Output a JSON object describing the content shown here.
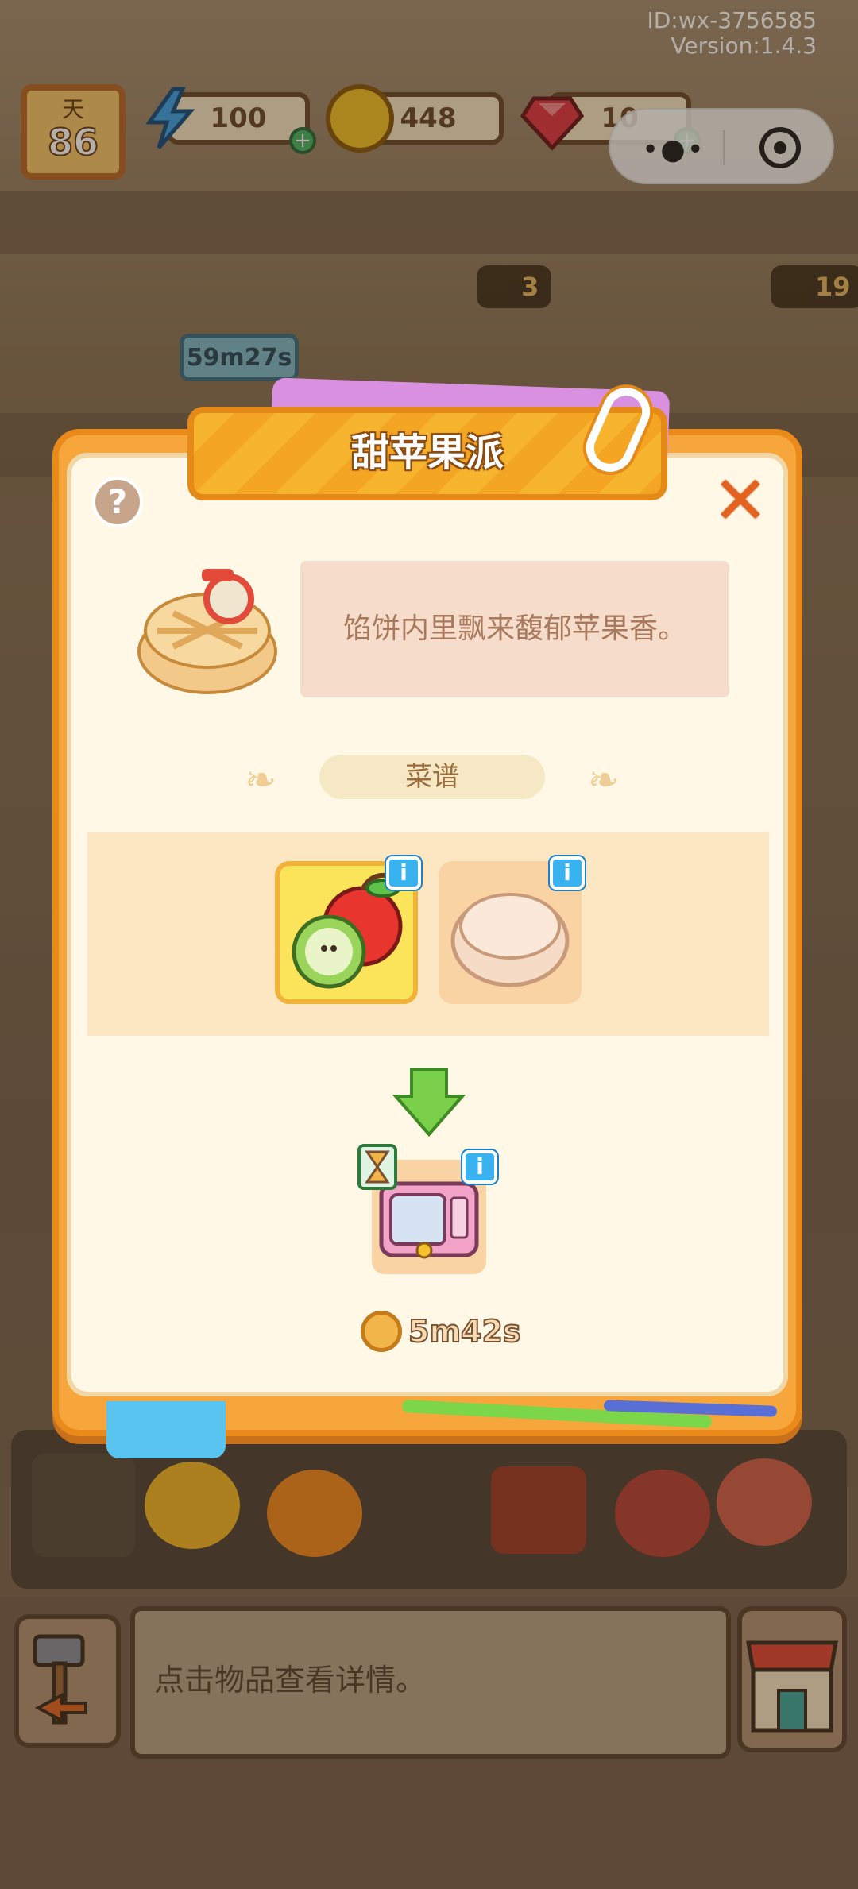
{
  "hud": {
    "id_line": "ID:wx-3756585",
    "version_line": "Version:1.4.3",
    "day_label": "天",
    "day_value": "86",
    "energy": "100",
    "coins": "448",
    "gems": "10",
    "energy_icon": "lightning-icon",
    "coin_icon": "coin-icon",
    "gem_icon": "ruby-icon"
  },
  "background": {
    "station_badges": [
      "3",
      "19"
    ],
    "station_timer": "59m27s"
  },
  "modal": {
    "title": "甜苹果派",
    "help": "?",
    "close": "✕",
    "description": "馅饼内里飘来馥郁苹果香。",
    "recipe_label": "菜谱",
    "ingredients": [
      {
        "name": "apples",
        "icon": "apple-icon",
        "info": "i",
        "selected": true
      },
      {
        "name": "pie-crust",
        "icon": "pie-crust-icon",
        "info": "i",
        "selected": false
      }
    ],
    "machine": {
      "icon": "microwave-icon",
      "info": "i"
    },
    "cook_time": "5m42s"
  },
  "bottom": {
    "hint_text": "点击物品查看详情。"
  },
  "colors": {
    "modal_orange": "#f6a63a",
    "title_yellow": "#f7b52f",
    "info_blue": "#39b3f0",
    "close_red": "#e4621f"
  }
}
